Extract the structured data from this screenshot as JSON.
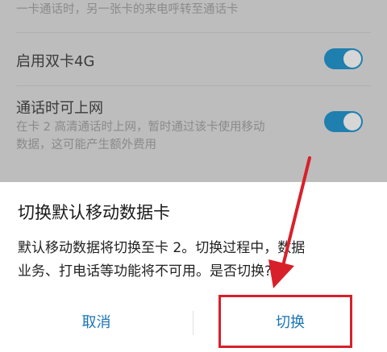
{
  "settings": {
    "row1_desc": "一卡通话时，另一张卡的来电呼转至通话卡",
    "dual_4g_label": "启用双卡4G",
    "dual_4g_on": true,
    "data_in_call_label": "通话时可上网",
    "data_in_call_desc_line1": "在卡 2 高清通话时上网，暂时通过该卡使用移动",
    "data_in_call_desc_line2": "数据，这可能产生额外费用",
    "data_in_call_on": true
  },
  "dialog": {
    "title": "切换默认移动数据卡",
    "body_line1": "默认移动数据将切换至卡 2。切换过程中，数据",
    "body_line2": "业务、打电话等功能将不可用。是否切换?",
    "cancel_label": "取消",
    "confirm_label": "切换"
  },
  "colors": {
    "accent": "#1a74b5",
    "toggle_on": "#1f7fae",
    "annotation": "#d8202a"
  }
}
